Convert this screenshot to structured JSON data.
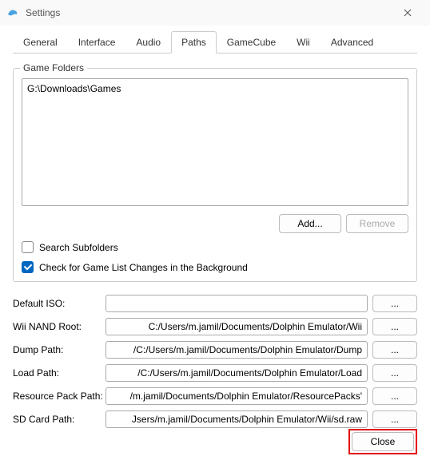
{
  "window": {
    "title": "Settings"
  },
  "tabs": {
    "general": "General",
    "interface": "Interface",
    "audio": "Audio",
    "paths": "Paths",
    "gamecube": "GameCube",
    "wii": "Wii",
    "advanced": "Advanced"
  },
  "gameFolders": {
    "legend": "Game Folders",
    "items": [
      "G:\\Downloads\\Games"
    ],
    "addLabel": "Add...",
    "removeLabel": "Remove",
    "searchSubfolders": "Search Subfolders",
    "checkBackground": "Check for Game List Changes in the Background"
  },
  "paths": {
    "defaultIso": {
      "label": "Default ISO:",
      "value": ""
    },
    "wiiNandRoot": {
      "label": "Wii NAND Root:",
      "value": "C:/Users/m.jamil/Documents/Dolphin Emulator/Wii"
    },
    "dumpPath": {
      "label": "Dump Path:",
      "value": "C:/Users/m.jamil/Documents/Dolphin Emulator/Dump/"
    },
    "loadPath": {
      "label": "Load Path:",
      "value": "C:/Users/m.jamil/Documents/Dolphin Emulator/Load/"
    },
    "resourcePackPath": {
      "label": "Resource Pack Path:",
      "value": "'m.jamil/Documents/Dolphin Emulator/ResourcePacks/"
    },
    "sdCardPath": {
      "label": "SD Card Path:",
      "value": "Jsers/m.jamil/Documents/Dolphin Emulator/Wii/sd.raw"
    },
    "browseLabel": "..."
  },
  "footer": {
    "closeLabel": "Close"
  }
}
